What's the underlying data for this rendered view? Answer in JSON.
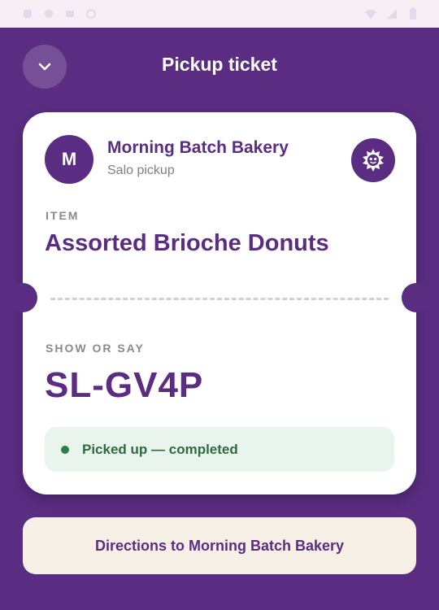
{
  "status_bar": {
    "icons": [
      "status-glyph-1",
      "status-glyph-2",
      "status-glyph-3",
      "status-glyph-4",
      "status-glyph-5"
    ],
    "right_icons": [
      "wifi-icon",
      "signal-icon",
      "battery-icon"
    ]
  },
  "header": {
    "title": "Pickup ticket",
    "back_icon": "chevron-down-icon"
  },
  "ticket": {
    "store": {
      "initial": "M",
      "name": "Morning Batch Bakery",
      "subtitle": "Salo pickup",
      "badge_icon": "sun-face-icon"
    },
    "item": {
      "label": "ITEM",
      "name": "Assorted Brioche Donuts"
    },
    "code": {
      "label": "SHOW OR SAY",
      "value": "SL-GV4P"
    },
    "status": {
      "text": "Picked up — completed",
      "color": "#2e7d46"
    }
  },
  "directions": {
    "label": "Directions to Morning Batch Bakery"
  },
  "colors": {
    "brand": "#5a2d82",
    "status_bg": "#e8f4ec",
    "button_bg": "#f7f0e7"
  }
}
